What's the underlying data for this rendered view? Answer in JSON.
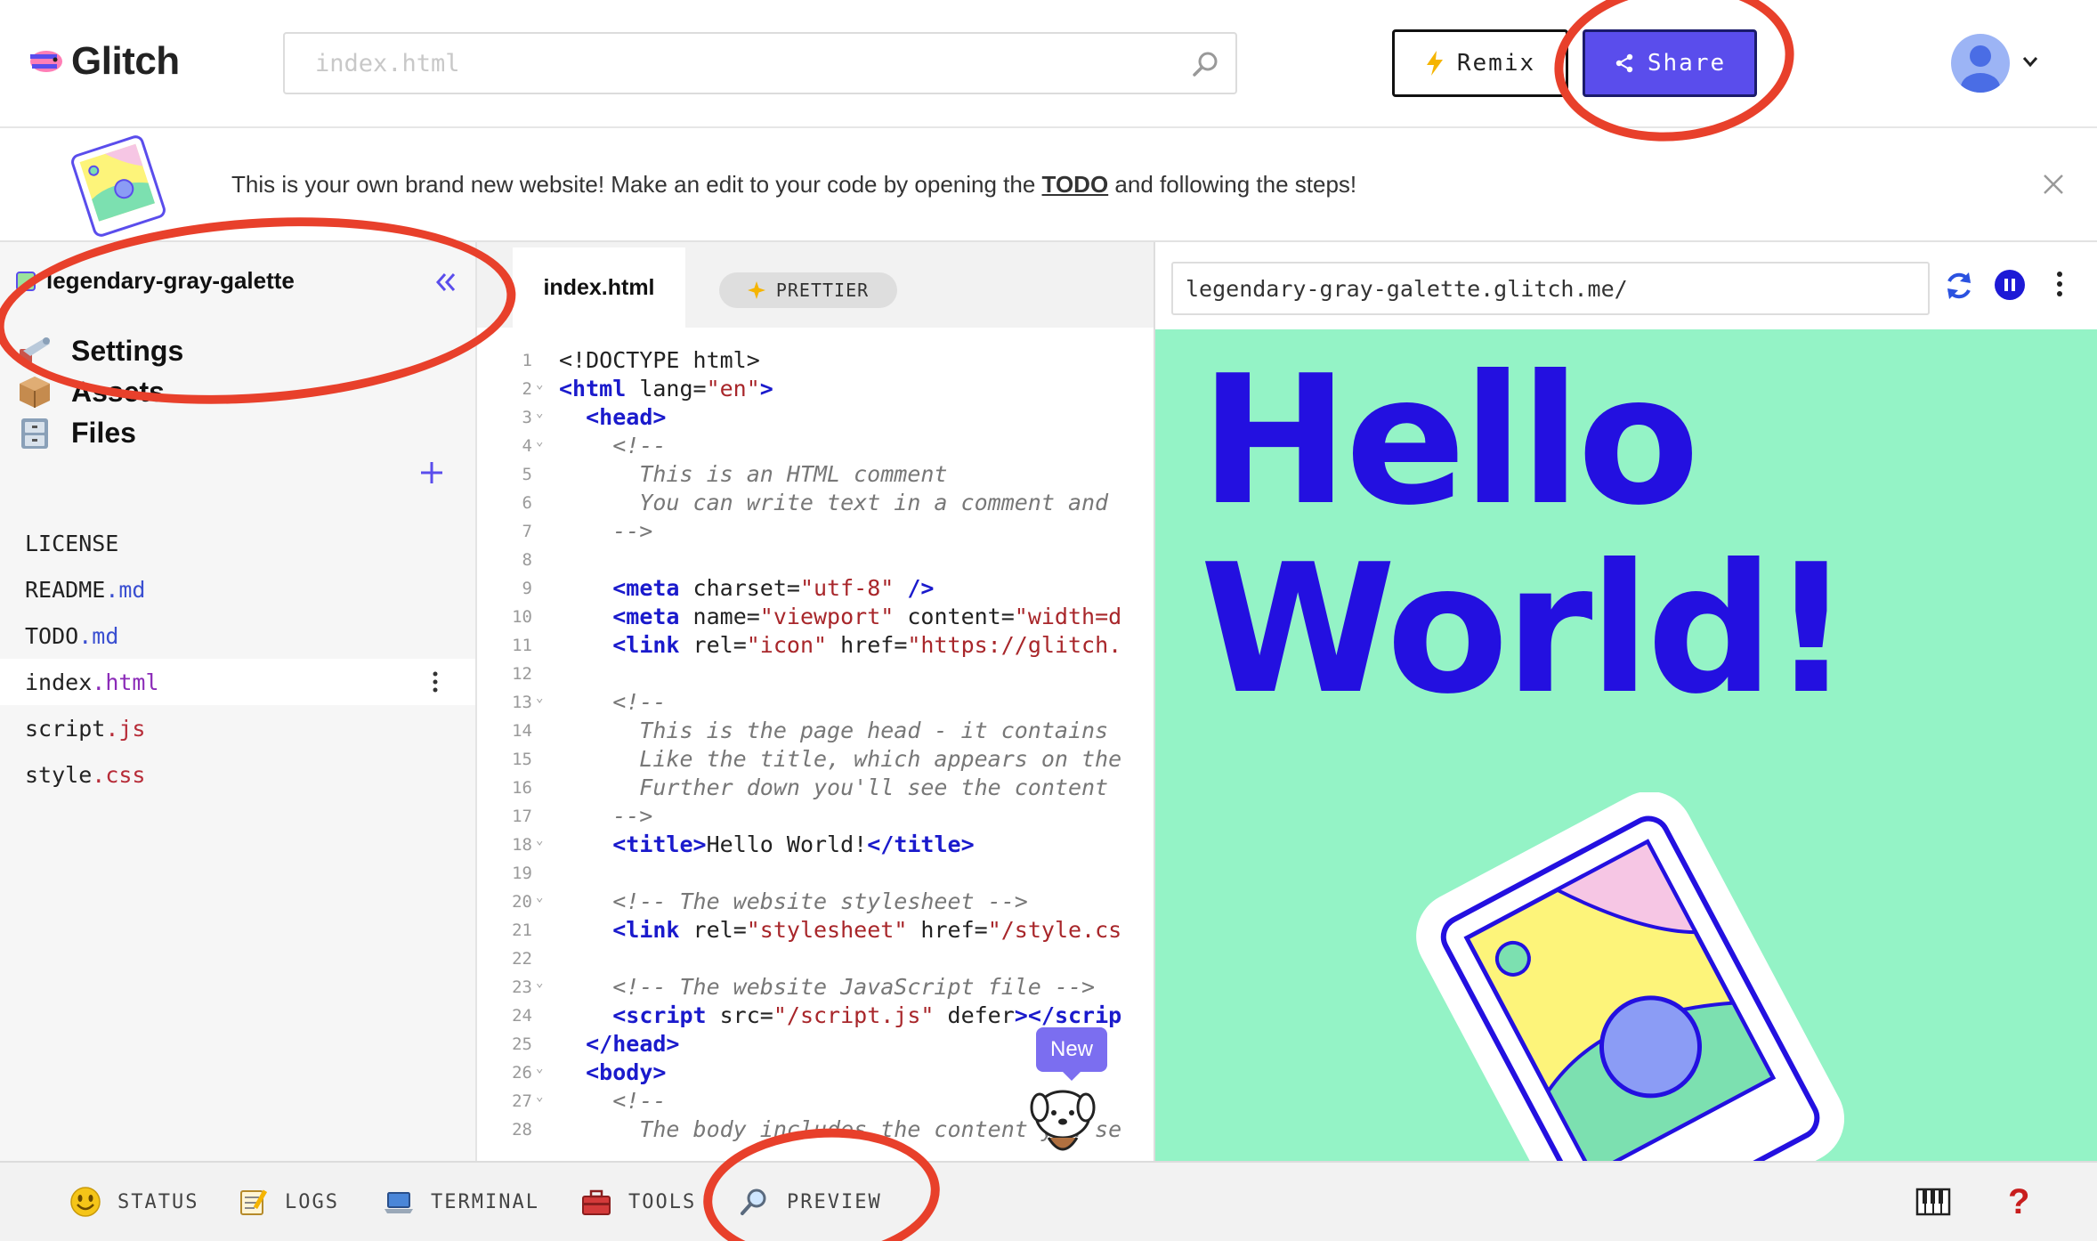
{
  "app": {
    "name": "Glitch"
  },
  "header": {
    "search_placeholder": "index.html",
    "remix_label": "Remix",
    "share_label": "Share"
  },
  "banner": {
    "text_before": "This is your own brand new website! Make an edit to your code by opening the ",
    "link": "TODO",
    "text_after": " and following the steps!"
  },
  "sidebar": {
    "project_name": "legendary-gray-galette",
    "nav": [
      {
        "label": "Settings"
      },
      {
        "label": "Assets"
      },
      {
        "label": "Files"
      }
    ],
    "files": [
      {
        "base": "LICENSE",
        "ext": ""
      },
      {
        "base": "README",
        "ext": ".md"
      },
      {
        "base": "TODO",
        "ext": ".md"
      },
      {
        "base": "index",
        "ext": ".html"
      },
      {
        "base": "script",
        "ext": ".js"
      },
      {
        "base": "style",
        "ext": ".css"
      }
    ]
  },
  "editor": {
    "tab": "index.html",
    "prettier_label": "PRETTIER",
    "new_badge": "New",
    "lines": [
      "<!DOCTYPE html>",
      "<html lang=\"en\">",
      "  <head>",
      "    <!--",
      "      This is an HTML comment",
      "      You can write text in a comment and",
      "    -->",
      "",
      "    <meta charset=\"utf-8\" />",
      "    <meta name=\"viewport\" content=\"width=d",
      "    <link rel=\"icon\" href=\"https://glitch.",
      "",
      "    <!--",
      "      This is the page head - it contains",
      "      Like the title, which appears on the",
      "      Further down you'll see the content",
      "    -->",
      "    <title>Hello World!</title>",
      "",
      "    <!-- The website stylesheet -->",
      "    <link rel=\"stylesheet\" href=\"/style.cs",
      "",
      "    <!-- The website JavaScript file -->",
      "    <script src=\"/script.js\" defer></scrip",
      "  </head>",
      "  <body>",
      "    <!--",
      "      The body includes the content you se"
    ]
  },
  "preview": {
    "url": "legendary-gray-galette.glitch.me/",
    "heading_line1": "Hello",
    "heading_line2": "World!"
  },
  "bottombar": {
    "items": [
      {
        "label": "STATUS"
      },
      {
        "label": "LOGS"
      },
      {
        "label": "TERMINAL"
      },
      {
        "label": "TOOLS"
      },
      {
        "label": "PREVIEW"
      }
    ],
    "help": "?"
  },
  "colors": {
    "accent": "#5a4dec",
    "hello_text": "#2310e0",
    "preview_bg": "#94f3c6",
    "annotation": "#e8402b"
  }
}
